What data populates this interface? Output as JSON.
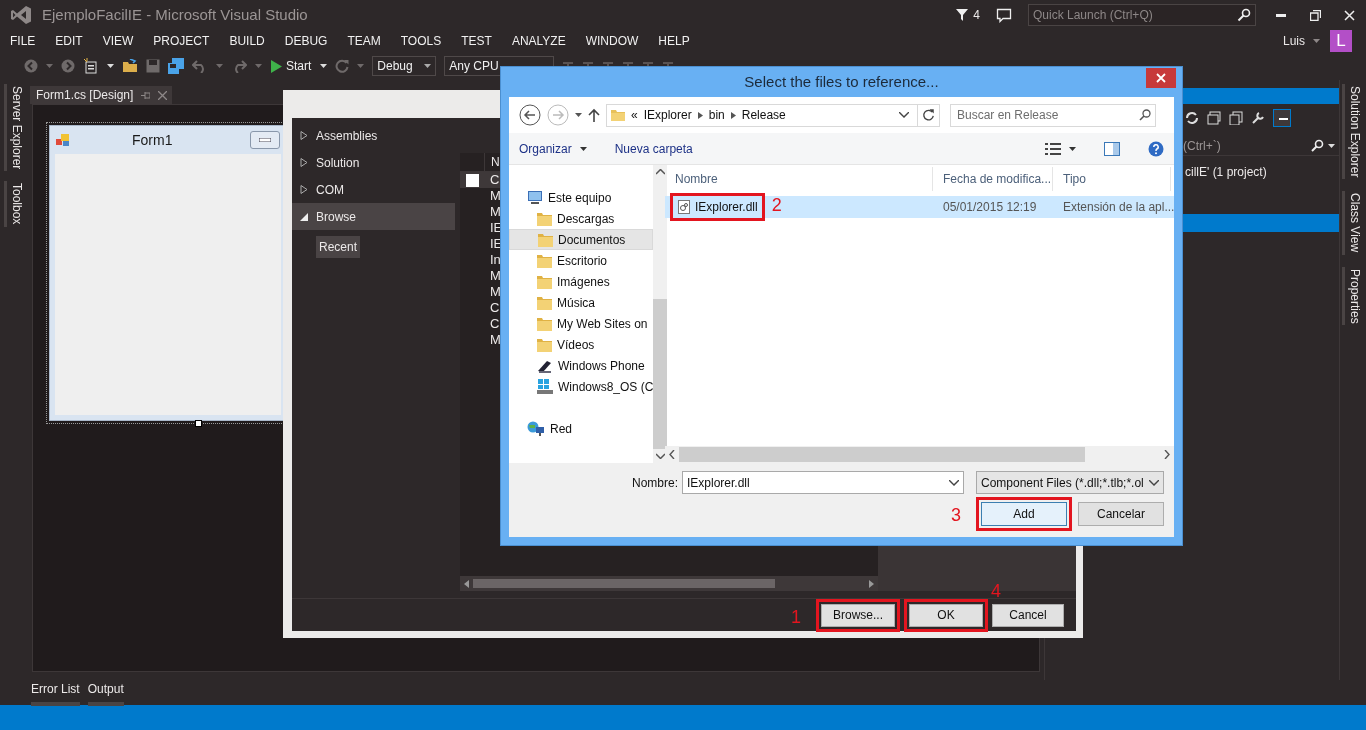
{
  "window": {
    "title": "EjemploFacilIE - Microsoft Visual Studio",
    "notification_count": "4",
    "quick_launch": {
      "placeholder": "Quick Launch (Ctrl+Q)"
    },
    "user": "Luis",
    "avatar": "L"
  },
  "menu": [
    "FILE",
    "EDIT",
    "VIEW",
    "PROJECT",
    "BUILD",
    "DEBUG",
    "TEAM",
    "TOOLS",
    "TEST",
    "ANALYZE",
    "WINDOW",
    "HELP"
  ],
  "toolbar": {
    "start": "Start",
    "configuration": "Debug",
    "platform": "Any CPU"
  },
  "left_tabs": [
    "Server Explorer",
    "Toolbox"
  ],
  "document_tab": "Form1.cs [Design]",
  "form": {
    "title": "Form1"
  },
  "reference_manager": {
    "nav": [
      {
        "label": "Assemblies",
        "expanded": false,
        "selected": false
      },
      {
        "label": "Solution",
        "expanded": false,
        "selected": false
      },
      {
        "label": "COM",
        "expanded": false,
        "selected": false
      },
      {
        "label": "Browse",
        "expanded": true,
        "selected": true,
        "children": [
          {
            "label": "Recent"
          }
        ]
      }
    ],
    "list_header": "N",
    "rows": [
      {
        "text": "C",
        "selected": true,
        "checked": false
      },
      {
        "text": "M",
        "selected": false
      },
      {
        "text": "M",
        "selected": false
      },
      {
        "text": "IE",
        "selected": false
      },
      {
        "text": "IE",
        "selected": false
      },
      {
        "text": "In",
        "selected": false
      },
      {
        "text": "M",
        "selected": false
      },
      {
        "text": "M",
        "selected": false
      },
      {
        "text": "C",
        "selected": false
      },
      {
        "text": "C",
        "selected": false
      },
      {
        "text": "M",
        "selected": false
      }
    ],
    "buttons": [
      {
        "label": "Browse...",
        "annotation": "1"
      },
      {
        "label": "OK",
        "annotation": "4"
      },
      {
        "label": "Cancel"
      }
    ]
  },
  "solution_explorer": {
    "search": "(Ctrl+`)",
    "items": [
      {
        "text": "cillE' (1 project)",
        "selected": false
      }
    ]
  },
  "right_tabs": [
    "Solution Explorer",
    "Class View",
    "Properties"
  ],
  "bottom_tabs": [
    "Error List",
    "Output"
  ],
  "file_dialog": {
    "title": "Select the files to reference...",
    "path_overflow": "«",
    "path": [
      "IExplorer",
      "bin",
      "Release"
    ],
    "search": {
      "placeholder": "Buscar en Release"
    },
    "commands": [
      "Organizar",
      "Nueva carpeta"
    ],
    "nav": [
      {
        "label": "Este equipo",
        "kind": "computer",
        "selected": false,
        "children": [
          {
            "label": "Descargas",
            "kind": "folder",
            "selected": false
          },
          {
            "label": "Documentos",
            "kind": "folder",
            "selected": true
          },
          {
            "label": "Escritorio",
            "kind": "folder",
            "selected": false
          },
          {
            "label": "Imágenes",
            "kind": "folder",
            "selected": false
          },
          {
            "label": "Música",
            "kind": "folder",
            "selected": false
          },
          {
            "label": "My Web Sites on",
            "kind": "folder",
            "selected": false
          },
          {
            "label": "Vídeos",
            "kind": "folder",
            "selected": false
          },
          {
            "label": "Windows Phone",
            "kind": "phone",
            "selected": false
          },
          {
            "label": "Windows8_OS (C",
            "kind": "drive",
            "selected": false
          }
        ]
      },
      {
        "label": "Red",
        "kind": "network",
        "selected": false
      }
    ],
    "columns": [
      "Nombre",
      "Fecha de modifica...",
      "Tipo"
    ],
    "files": [
      {
        "name": "IExplorer.dll",
        "date": "05/01/2015 12:19",
        "type": "Extensión de la apl...",
        "selected": true,
        "annotation": "2"
      }
    ],
    "file_name": {
      "label": "Nombre:",
      "value": "IExplorer.dll"
    },
    "filter": "Component Files (*.dll;*.tlb;*.ol",
    "buttons": [
      {
        "label": "Add",
        "annotation": "3"
      },
      {
        "label": "Cancelar"
      }
    ]
  }
}
